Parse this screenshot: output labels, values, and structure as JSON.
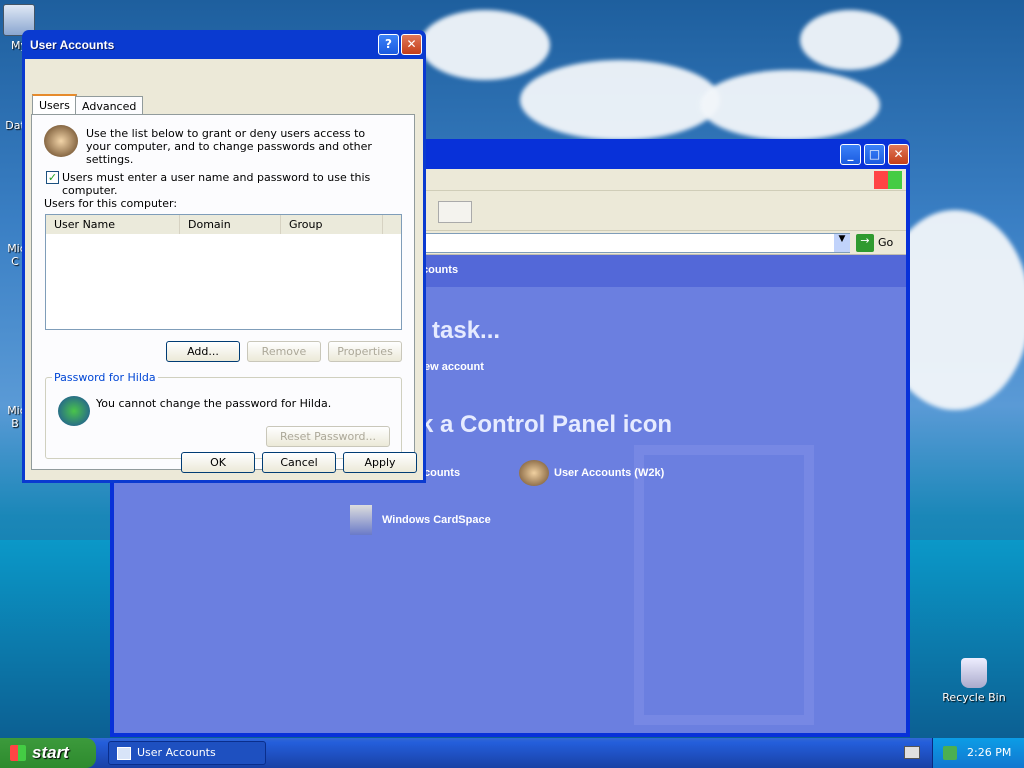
{
  "desktop": {
    "icons": [
      {
        "label": "My",
        "icon": "my-computer-icon"
      },
      {
        "label": "Dat",
        "icon": "data-icon"
      },
      {
        "label": "Micro\nC",
        "icon": "microsoft-icon"
      },
      {
        "label": "Micro\nB",
        "icon": "microsoft-icon"
      },
      {
        "label": "Recycle Bin",
        "icon": "recycle-bin-icon"
      }
    ]
  },
  "cp_window": {
    "go_label": "Go",
    "header_fragment": "counts",
    "pick_task": "task...",
    "create_account": "ew account",
    "pick_icon": "k a Control Panel icon",
    "item_accounts": "counts",
    "item_w2k": "User Accounts (W2k)",
    "item_cardspace": "Windows CardSpace"
  },
  "dialog": {
    "title": "User Accounts",
    "tabs": [
      "Users",
      "Advanced"
    ],
    "intro": "Use the list below to grant or deny users access to your computer, and to change passwords and other settings.",
    "require_password_label": "Users must enter a user name and password to use this computer.",
    "require_password_checked": true,
    "users_label": "Users for this computer:",
    "columns": [
      "User Name",
      "Domain",
      "Group"
    ],
    "rows": [],
    "add_label": "Add...",
    "remove_label": "Remove",
    "properties_label": "Properties",
    "password_group_title": "Password for Hilda",
    "password_text": "You cannot change the password for Hilda.",
    "reset_label": "Reset Password...",
    "ok_label": "OK",
    "cancel_label": "Cancel",
    "apply_label": "Apply"
  },
  "taskbar": {
    "start_label": "start",
    "task_label": "User Accounts",
    "clock": "2:26 PM"
  }
}
